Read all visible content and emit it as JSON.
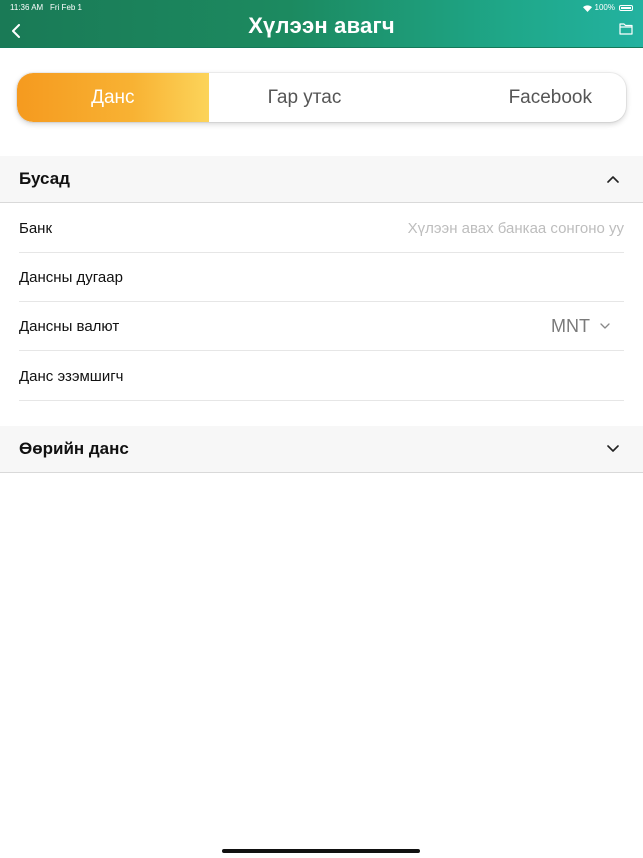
{
  "status_bar": {
    "time": "11:36 AM",
    "date": "Fri Feb 1",
    "battery": "100%"
  },
  "header": {
    "title": "Хүлээн авагч"
  },
  "tabs": [
    {
      "label": "Данс",
      "active": true
    },
    {
      "label": "Гар утас",
      "active": false
    },
    {
      "label": "Facebook",
      "active": false
    }
  ],
  "sections": {
    "other": {
      "title": "Бусад",
      "expanded": true,
      "fields": {
        "bank": {
          "label": "Банк",
          "placeholder": "Хүлээн авах банкаа сонгоно уу"
        },
        "account_number": {
          "label": "Дансны дугаар"
        },
        "currency": {
          "label": "Дансны валют",
          "value": "MNT"
        },
        "holder": {
          "label": "Данс эзэмшигч"
        }
      }
    },
    "own": {
      "title": "Өөрийн данс",
      "expanded": false
    }
  },
  "colors": {
    "header_start": "#1a7a56",
    "header_end": "#23b2a0",
    "tab_active_start": "#f59a1f",
    "tab_active_end": "#fcd45a"
  }
}
